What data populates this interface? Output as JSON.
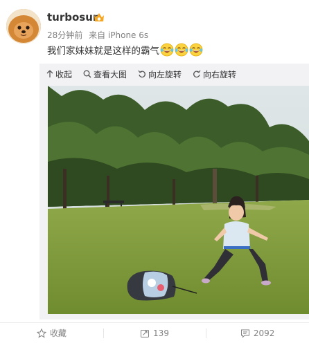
{
  "post": {
    "username": "turbosun",
    "time": "28分钟前",
    "source": "来自 iPhone 6s",
    "text": "我们家妹妹就是这样的霸气",
    "emoji_count": 3,
    "emoji_icon": "laughing-tears-emoji"
  },
  "photo_toolbar": {
    "collapse": "收起",
    "view_large": "查看大图",
    "rotate_left": "向左旋转",
    "rotate_right": "向右旋转"
  },
  "footer": {
    "favorite": "收藏",
    "repost_count": "139",
    "comment_count": "2092"
  },
  "colors": {
    "text": "#333333",
    "meta": "#808080",
    "toolbar_bg": "#f2f2f5",
    "vip_badge": "#f5a623"
  }
}
